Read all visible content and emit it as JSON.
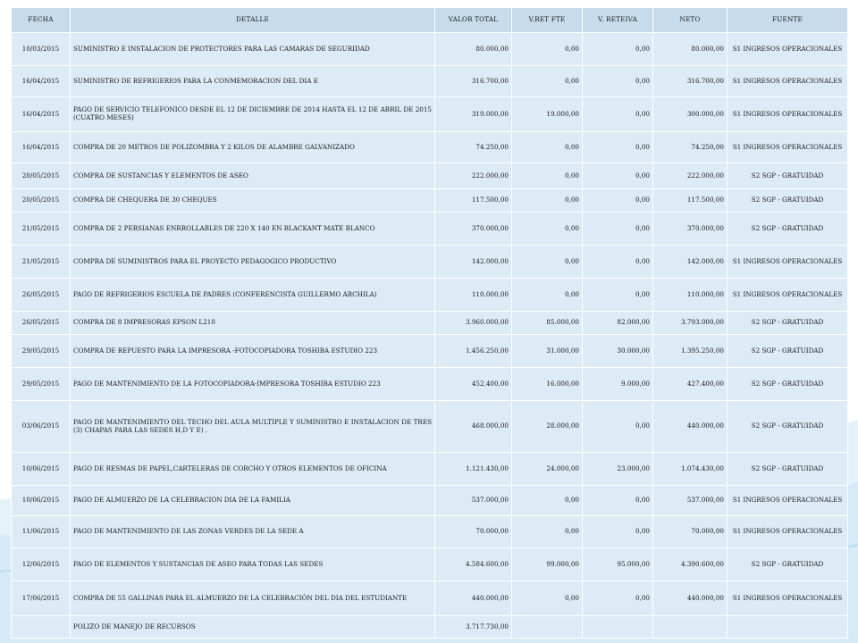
{
  "headers": [
    "FECHA",
    "DETALLE",
    "VALOR TOTAL",
    "V.RET FTE",
    "V. RETEIVA",
    "NETO",
    "FUENTE"
  ],
  "rows": [
    {
      "fecha": "10/03/2015",
      "detalle": "SUMINISTRO E INSTALACION DE PROTECTORES PARA LAS CAMARAS DE SEGURIDAD",
      "valor": "80.000,00",
      "retfte": "0,00",
      "reteiva": "0,00",
      "neto": "80.000,00",
      "fuente": "S1 INGRESOS OPERACIONALES"
    },
    {
      "fecha": "16/04/2015",
      "detalle": "SUMINISTRO DE REFRIGERIOS PARA LA CONMEMORACION DEL DIA E",
      "valor": "316.700,00",
      "retfte": "0,00",
      "reteiva": "0,00",
      "neto": "316.700,00",
      "fuente": "S1 INGRESOS OPERACIONALES"
    },
    {
      "fecha": "16/04/2015",
      "detalle": "PAGO DE SERVICIO TELEFONICO DESDE EL 12 DE DICIEMBRE DE 2014 HASTA EL 12 DE ABRIL DE 2015 (CUATRO MESES)",
      "valor": "319.000,00",
      "retfte": "19.000,00",
      "reteiva": "0,00",
      "neto": "300.000,00",
      "fuente": "S1 INGRESOS OPERACIONALES"
    },
    {
      "fecha": "16/04/2015",
      "detalle": "COMPRA DE 20 METROS DE POLIZOMBRA Y 2 KILOS DE ALAMBRE GALVANIZADO",
      "valor": "74.250,00",
      "retfte": "0,00",
      "reteiva": "0,00",
      "neto": "74.250,00",
      "fuente": "S1 INGRESOS OPERACIONALES"
    },
    {
      "fecha": "20/05/2015",
      "detalle": "COMPRA DE SUSTANCIAS Y ELEMENTOS DE ASEO",
      "valor": "222.000,00",
      "retfte": "0,00",
      "reteiva": "0,00",
      "neto": "222.000,00",
      "fuente": "S2 SGP - GRATUIDAD"
    },
    {
      "fecha": "20/05/2015",
      "detalle": "COMPRA DE CHEQUERA DE 30 CHEQUES",
      "valor": "117.500,00",
      "retfte": "0,00",
      "reteiva": "0,00",
      "neto": "117.500,00",
      "fuente": "S2 SGP - GRATUIDAD"
    },
    {
      "fecha": "21/05/2015",
      "detalle": "COMPRA DE 2 PERSIANAS ENRROLLABLES DE 220 X 140 EN BLACKANT MATE BLANCO",
      "valor": "370.000,00",
      "retfte": "0,00",
      "reteiva": "0,00",
      "neto": "370.000,00",
      "fuente": "S2 SGP - GRATUIDAD"
    },
    {
      "fecha": "21/05/2015",
      "detalle": "COMPRA DE SUMINISTROS PARA EL PROYECTO PEDAGOGICO PRODUCTIVO",
      "valor": "142.000,00",
      "retfte": "0,00",
      "reteiva": "0,00",
      "neto": "142.000,00",
      "fuente": "S1 INGRESOS OPERACIONALES"
    },
    {
      "fecha": "26/05/2015",
      "detalle": "PAGO DE REFRIGERIOS ESCUELA DE PADRES (CONFERENCISTA GUILLERMO ARCHILA)",
      "valor": "110.000,00",
      "retfte": "0,00",
      "reteiva": "0,00",
      "neto": "110.000,00",
      "fuente": "S1 INGRESOS OPERACIONALES"
    },
    {
      "fecha": "26/05/2015",
      "detalle": "COMPRA DE 8 IMPRESORAS EPSON L210",
      "valor": "3.960.000,00",
      "retfte": "85.000,00",
      "reteiva": "82.000,00",
      "neto": "3.793.000,00",
      "fuente": "S2 SGP - GRATUIDAD"
    },
    {
      "fecha": "29/05/2015",
      "detalle": "COMPRA DE REPUESTO PARA LA IMPRESORA -FOTOCOPIADORA TOSHIBA ESTUDIO 223",
      "valor": "1.456.250,00",
      "retfte": "31.000,00",
      "reteiva": "30.000,00",
      "neto": "1.395.250,00",
      "fuente": "S2 SGP - GRATUIDAD"
    },
    {
      "fecha": "29/05/2015",
      "detalle": "PAGO DE MANTENIMIENTO DE LA FOTOCOPIADORA-IMPRESORA TOSHIBA ESTUDIO 223",
      "valor": "452.400,00",
      "retfte": "16.000,00",
      "reteiva": "9.000,00",
      "neto": "427.400,00",
      "fuente": "S2 SGP - GRATUIDAD"
    },
    {
      "fecha": "03/06/2015",
      "detalle": "PAGO DE MANTENIMIENTO DEL TECHO DEL AULA MULTIPLE Y SUMINISTRO E INSTALACION DE TRES (3) CHAPAS PARA LAS SEDES H,D Y E) .",
      "valor": "468.000,00",
      "retfte": "28.000,00",
      "reteiva": "0,00",
      "neto": "440.000,00",
      "fuente": "S2 SGP - GRATUIDAD"
    },
    {
      "fecha": "10/06/2015",
      "detalle": "PAGO DE RESMAS DE PAPEL,CARTELERAS DE CORCHO Y OTROS ELEMENTOS DE OFICINA",
      "valor": "1.121.430,00",
      "retfte": "24.000,00",
      "reteiva": "23.000,00",
      "neto": "1.074.430,00",
      "fuente": "S2 SGP - GRATUIDAD"
    },
    {
      "fecha": "10/06/2015",
      "detalle": "PAGO DE ALMUERZO DE LA CELEBRACIÓN DIA DE LA FAMILIA",
      "valor": "537.000,00",
      "retfte": "0,00",
      "reteiva": "0,00",
      "neto": "537.000,00",
      "fuente": "S1 INGRESOS OPERACIONALES"
    },
    {
      "fecha": "11/06/2015",
      "detalle": "PAGO DE MANTENIMIENTO DE LAS ZONAS VERDES DE LA SEDE A",
      "valor": "70.000,00",
      "retfte": "0,00",
      "reteiva": "0,00",
      "neto": "70.000,00",
      "fuente": "S1 INGRESOS OPERACIONALES"
    },
    {
      "fecha": "12/06/2015",
      "detalle": "PAGO DE ELEMENTOS Y SUSTANCIAS DE ASEO PARA TODAS LAS SEDES",
      "valor": "4.584.600,00",
      "retfte": "99.000,00",
      "reteiva": "95.000,00",
      "neto": "4.390.600,00",
      "fuente": "S2 SGP - GRATUIDAD"
    },
    {
      "fecha": "17/06/2015",
      "detalle": "COMPRA DE 55 GALLINAS PARA EL ALMUERZO DE LA CELEBRACIÓN DEL DIA DEL ESTUDIANTE",
      "valor": "440.000,00",
      "retfte": "0,00",
      "reteiva": "0,00",
      "neto": "440.000,00",
      "fuente": "S1 INGRESOS OPERACIONALES"
    },
    {
      "fecha": "",
      "detalle": "POLIZO DE MANEJO DE RECURSOS",
      "valor": "3.717.730,00",
      "retfte": "",
      "reteiva": "",
      "neto": "",
      "fuente": ""
    }
  ]
}
